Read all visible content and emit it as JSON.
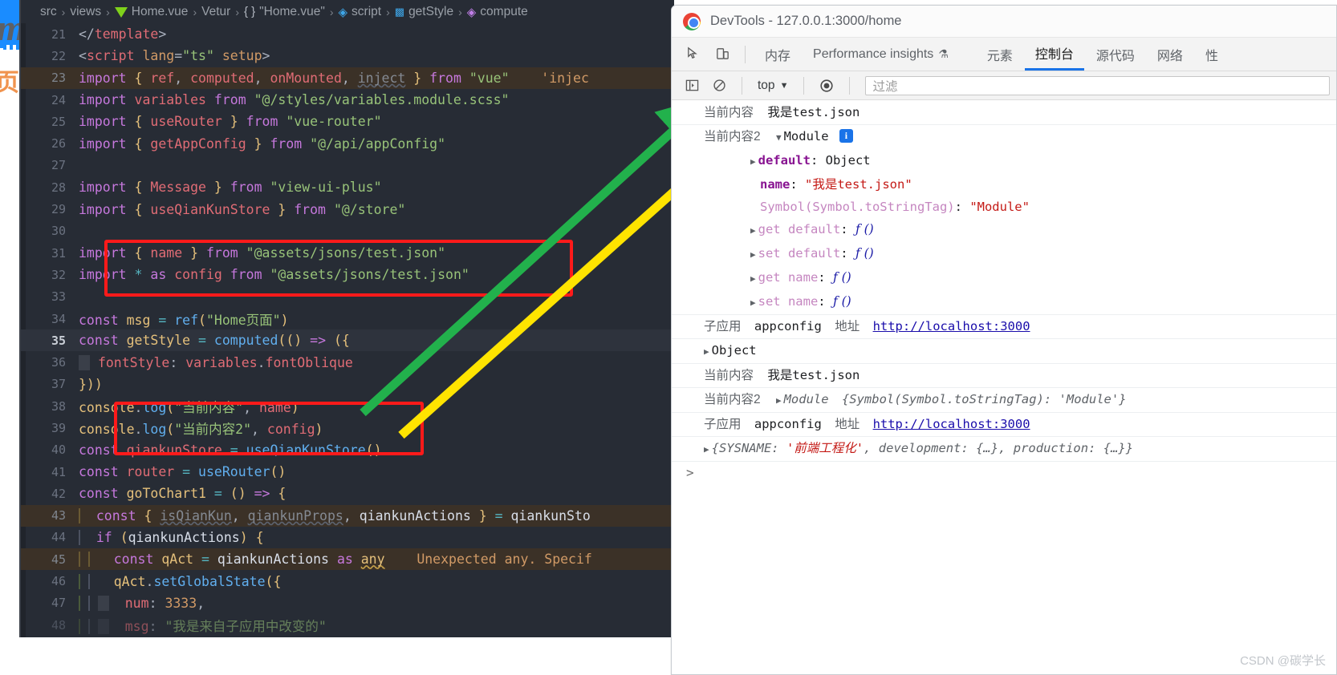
{
  "background": {
    "logo_letter": "m",
    "cjk_label": "页面"
  },
  "editor": {
    "breadcrumb": [
      {
        "label": "src",
        "icon": ""
      },
      {
        "label": "views",
        "icon": ""
      },
      {
        "label": "Home.vue",
        "icon": "vue-file-icon"
      },
      {
        "label": "Vetur",
        "icon": ""
      },
      {
        "label": "\"Home.vue\"",
        "icon": "braces-icon"
      },
      {
        "label": "script",
        "icon": "cube-icon"
      },
      {
        "label": "getStyle",
        "icon": "symbol-icon"
      },
      {
        "label": "compute",
        "icon": "cube-purple-icon"
      }
    ],
    "lines": [
      {
        "no": "21",
        "text": "</template>"
      },
      {
        "no": "22",
        "text": "<script lang=\"ts\" setup>"
      },
      {
        "no": "23",
        "text": "import { ref, computed, onMounted, inject } from \"vue\"    'injec"
      },
      {
        "no": "24",
        "text": "import variables from \"@/styles/variables.module.scss\""
      },
      {
        "no": "25",
        "text": "import { useRouter } from \"vue-router\""
      },
      {
        "no": "26",
        "text": "import { getAppConfig } from \"@/api/appConfig\""
      },
      {
        "no": "27",
        "text": ""
      },
      {
        "no": "28",
        "text": "import { Message } from \"view-ui-plus\""
      },
      {
        "no": "29",
        "text": "import { useQianKunStore } from \"@/store\""
      },
      {
        "no": "30",
        "text": ""
      },
      {
        "no": "31",
        "text": "import { name } from \"@assets/jsons/test.json\""
      },
      {
        "no": "32",
        "text": "import * as config from \"@assets/jsons/test.json\""
      },
      {
        "no": "33",
        "text": ""
      },
      {
        "no": "34",
        "text": "const msg = ref(\"Home页面\")"
      },
      {
        "no": "35",
        "text": "const getStyle = computed(() => ({"
      },
      {
        "no": "36",
        "text": "  fontStyle: variables.fontOblique"
      },
      {
        "no": "37",
        "text": "}))"
      },
      {
        "no": "38",
        "text": "console.log(\"当前内容\", name)"
      },
      {
        "no": "39",
        "text": "console.log(\"当前内容2\", config)"
      },
      {
        "no": "40",
        "text": "const qiankunStore = useQianKunStore()"
      },
      {
        "no": "41",
        "text": "const router = useRouter()"
      },
      {
        "no": "42",
        "text": "const goToChart1 = () => {"
      },
      {
        "no": "43",
        "text": "  const { isQianKun, qiankunProps, qiankunActions } = qiankunSto"
      },
      {
        "no": "44",
        "text": "  if (qiankunActions) {"
      },
      {
        "no": "45",
        "text": "    const qAct = qiankunActions as any    Unexpected any. Specif"
      },
      {
        "no": "46",
        "text": "    qAct.setGlobalState({"
      },
      {
        "no": "47",
        "text": "      num: 3333,"
      },
      {
        "no": "48",
        "text": "      msg: \"我是来自子应用中改变的\""
      }
    ],
    "annotation_color": "#ff1a1a",
    "arrow_green": "#22b14c",
    "arrow_yellow": "#ffe400"
  },
  "devtools": {
    "window_title": "DevTools - 127.0.0.1:3000/home",
    "toolbar_icons": [
      "inspect-element-icon",
      "device-toolbar-icon"
    ],
    "tabs": [
      {
        "label": "内存",
        "active": false
      },
      {
        "label": "Performance insights",
        "active": false,
        "badge": "flask-icon"
      },
      {
        "label": "元素",
        "active": false
      },
      {
        "label": "控制台",
        "active": true
      },
      {
        "label": "源代码",
        "active": false
      },
      {
        "label": "网络",
        "active": false
      },
      {
        "label": "性",
        "active": false
      }
    ],
    "console_bar": {
      "sidebar_icon": "console-sidebar-icon",
      "clear_icon": "clear-console-icon",
      "context": "top",
      "context_caret": "▼",
      "eye_icon": "live-expression-icon",
      "filter_placeholder": "过滤"
    },
    "messages": [
      {
        "id": "m1",
        "kind": "log",
        "parts": [
          {
            "t": "cjk",
            "v": "当前内容"
          },
          {
            "t": "mono",
            "v": "我是test.json"
          }
        ]
      },
      {
        "id": "m2",
        "kind": "log-expanded",
        "label_cjk": "当前内容2",
        "tri": "▼",
        "type_name": "Module",
        "badge": "i",
        "children": [
          {
            "tri": "▶",
            "name": "default",
            "sep": ": ",
            "value": "Object",
            "value_class": "obj",
            "indent": 2
          },
          {
            "tri": "",
            "name": "name",
            "sep": ": ",
            "value": "\"我是test.json\"",
            "value_class": "str",
            "indent": 3
          },
          {
            "tri": "",
            "name": "Symbol(Symbol.toStringTag)",
            "name_class": "prop-name-l",
            "sep": ": ",
            "value": "\"Module\"",
            "value_class": "str",
            "indent": 3
          },
          {
            "tri": "▶",
            "name": "get default",
            "name_class": "prop-name-l",
            "sep": ": ",
            "value": "ƒ ()",
            "value_class": "fn",
            "indent": 2
          },
          {
            "tri": "▶",
            "name": "set default",
            "name_class": "prop-name-l",
            "sep": ": ",
            "value": "ƒ ()",
            "value_class": "fn",
            "indent": 2
          },
          {
            "tri": "▶",
            "name": "get name",
            "name_class": "prop-name-l",
            "sep": ": ",
            "value": "ƒ ()",
            "value_class": "fn",
            "indent": 2
          },
          {
            "tri": "▶",
            "name": "set name",
            "name_class": "prop-name-l",
            "sep": ": ",
            "value": "ƒ ()",
            "value_class": "fn",
            "indent": 2
          }
        ]
      },
      {
        "id": "m3",
        "kind": "log-link",
        "cjk1": "子应用",
        "mono1": "appconfig",
        "cjk2": "地址",
        "link": "http://localhost:3000"
      },
      {
        "id": "m4",
        "kind": "object-collapsed",
        "tri": "▶",
        "text": "Object"
      },
      {
        "id": "m5",
        "kind": "log",
        "parts": [
          {
            "t": "cjk",
            "v": "当前内容"
          },
          {
            "t": "mono",
            "v": "我是test.json"
          }
        ]
      },
      {
        "id": "m6",
        "kind": "log-module-collapsed",
        "label_cjk": "当前内容2",
        "tri": "▶",
        "type_name": "Module",
        "preview": "{Symbol(Symbol.toStringTag): 'Module'}",
        "preview_str": "'Module'"
      },
      {
        "id": "m7",
        "kind": "log-link",
        "cjk1": "子应用",
        "mono1": "appconfig",
        "cjk2": "地址",
        "link": "http://localhost:3000"
      },
      {
        "id": "m8",
        "kind": "sysname",
        "tri": "▶",
        "prefix": "{SYSNAME: ",
        "str": "'前端工程化'",
        "suffix": ", development: {…}, production: {…}}"
      }
    ],
    "prompt_symbol": ">"
  },
  "watermark": "CSDN @碳学长"
}
